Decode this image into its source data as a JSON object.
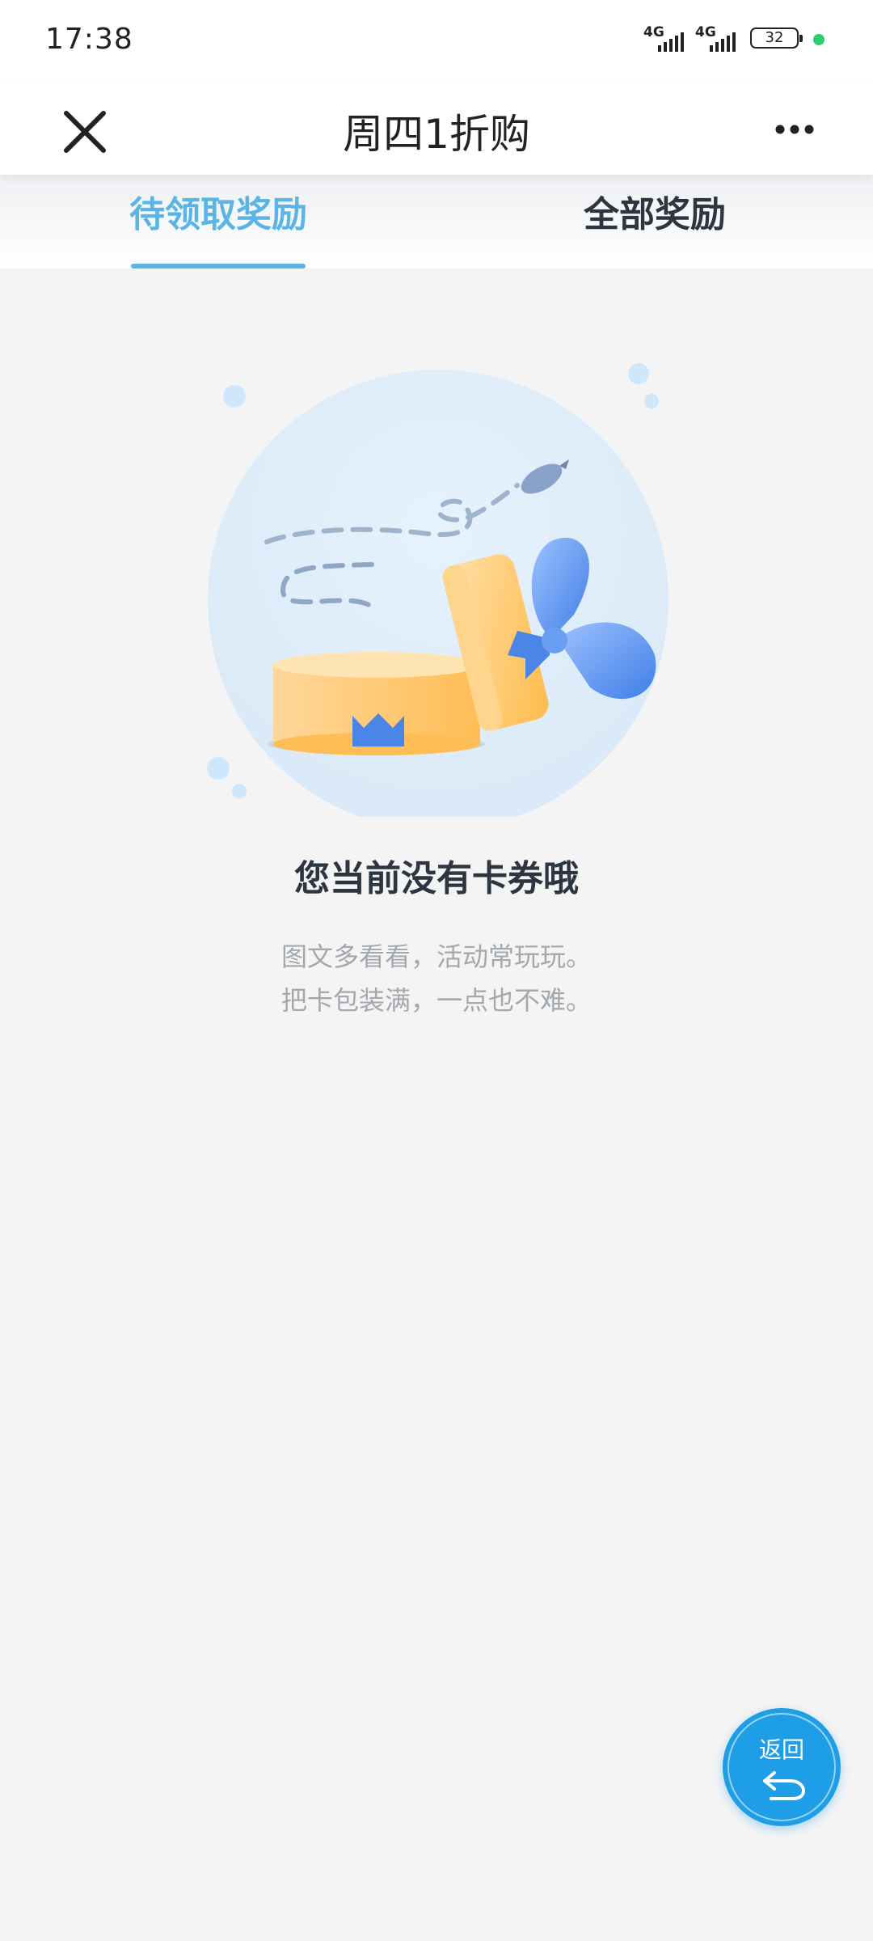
{
  "status_bar": {
    "time": "17:38",
    "network_1": "4G",
    "network_2": "4G",
    "battery": "32"
  },
  "navbar": {
    "title": "周四1折购",
    "close_icon": "close-icon",
    "more_icon": "more-icon"
  },
  "tabs": [
    {
      "label": "待领取奖励",
      "active": true
    },
    {
      "label": "全部奖励",
      "active": false
    }
  ],
  "empty_state": {
    "illustration": "gift-box-illustration",
    "title": "您当前没有卡券哦",
    "subtitle_line1": "图文多看看，活动常玩玩。",
    "subtitle_line2": "把卡包装满，一点也不难。"
  },
  "back_button": {
    "label": "返回",
    "icon": "return-arrow-icon"
  },
  "colors": {
    "accent": "#5ab4e6",
    "fab": "#1d9ee6",
    "title_text": "#2c3540",
    "muted_text": "#a3a8ad",
    "background": "#f4f4f5"
  }
}
